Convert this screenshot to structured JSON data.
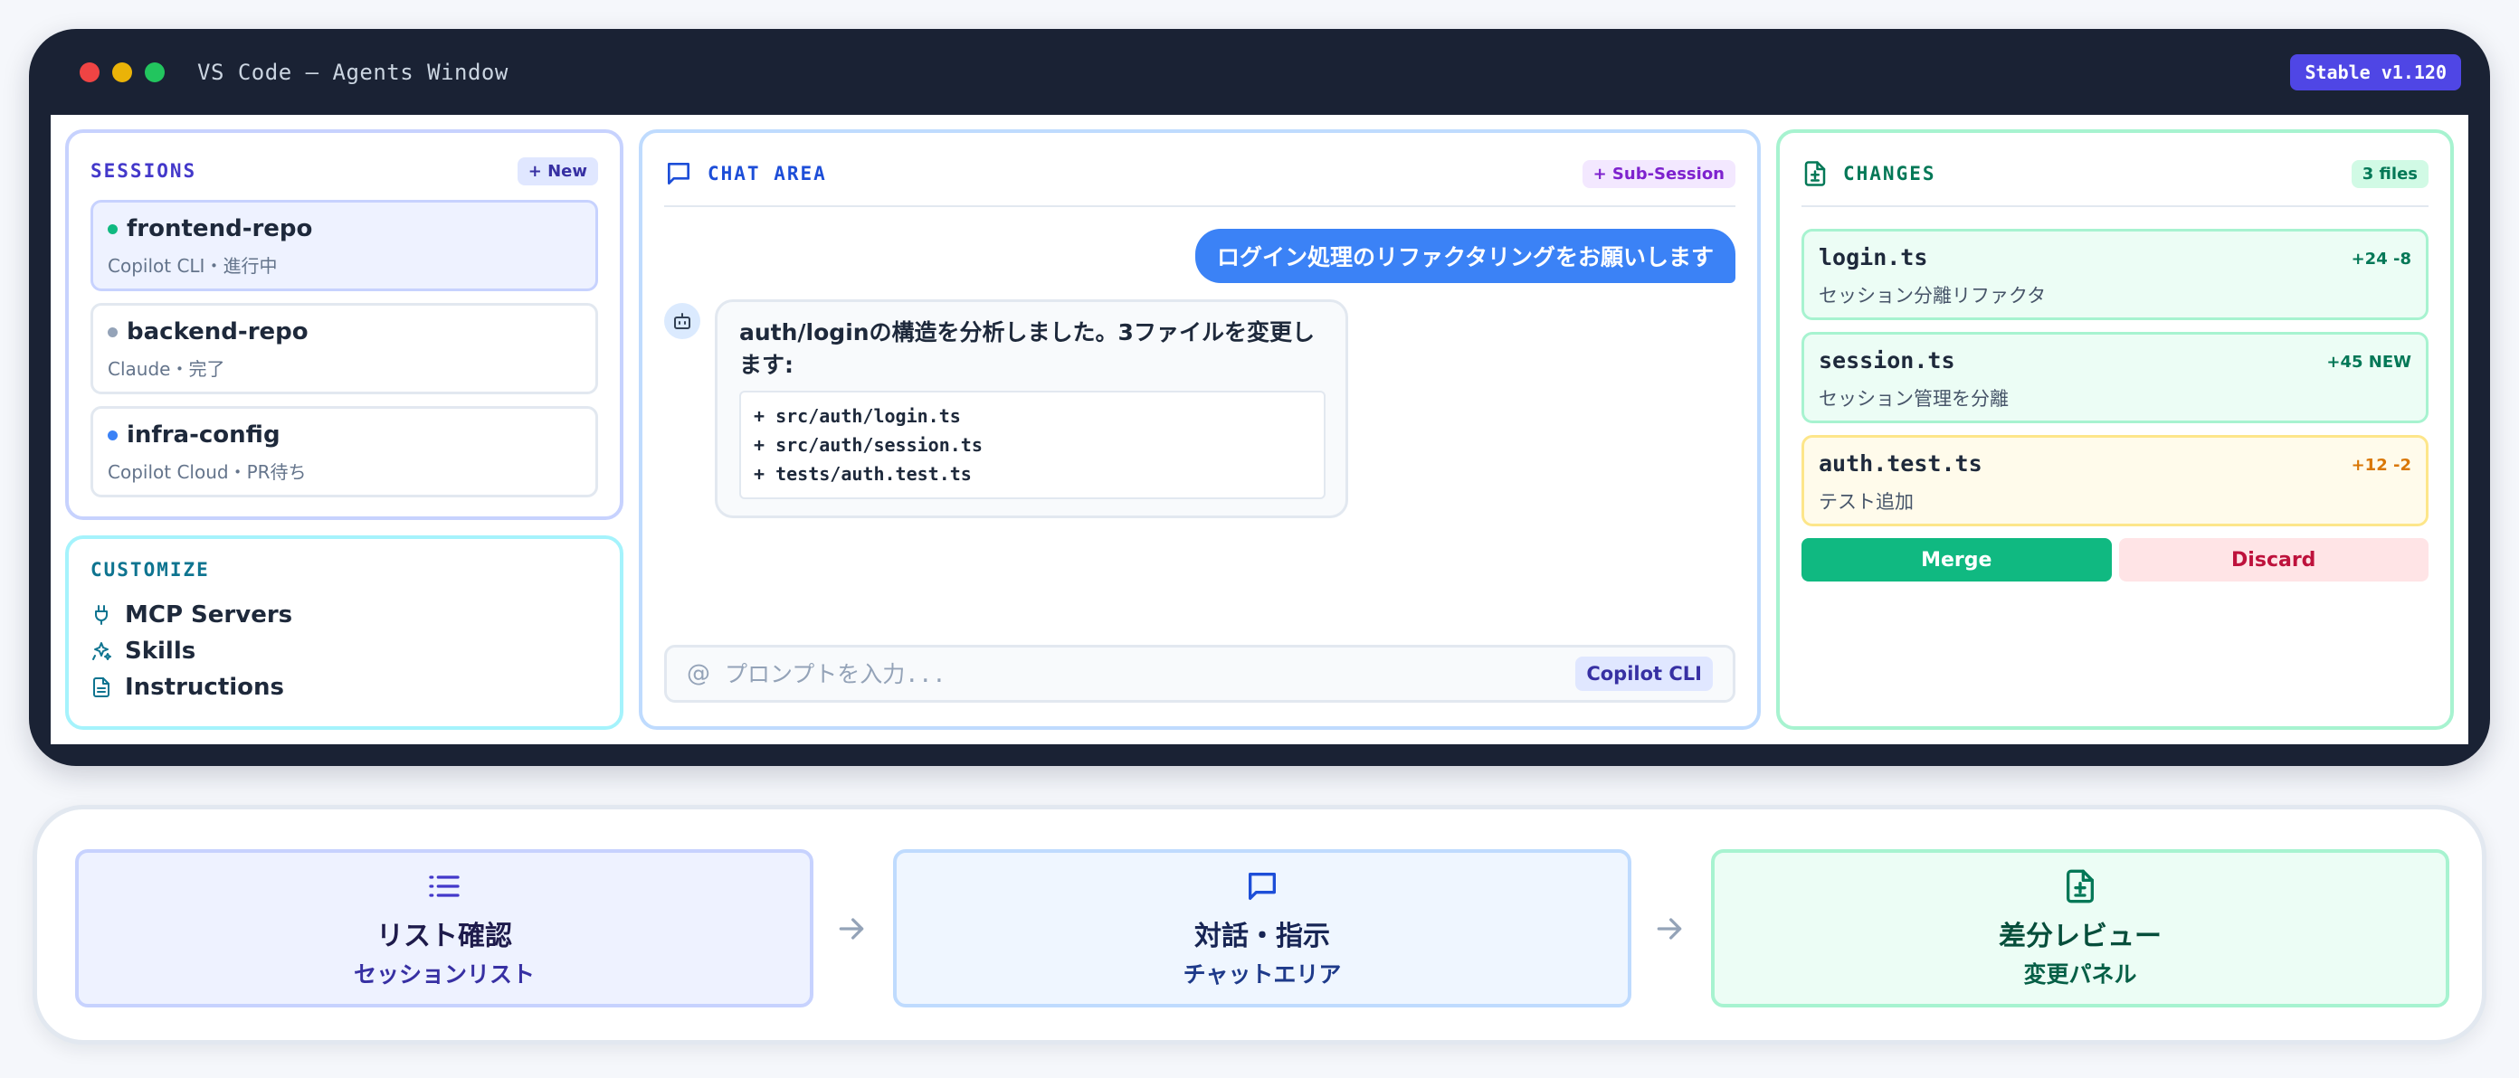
{
  "window": {
    "title": "VS Code — Agents Window",
    "version": "Stable v1.120"
  },
  "sessions": {
    "label": "SESSIONS",
    "new_label": "+ New",
    "items": [
      {
        "name": "frontend-repo",
        "meta": "Copilot CLI・進行中",
        "status_color": "#10b981"
      },
      {
        "name": "backend-repo",
        "meta": "Claude・完了",
        "status_color": "#94a3b8"
      },
      {
        "name": "infra-config",
        "meta": "Copilot Cloud・PR待ち",
        "status_color": "#3b82f6"
      }
    ]
  },
  "customize": {
    "label": "CUSTOMIZE",
    "items": [
      {
        "label": "MCP Servers",
        "icon": "plug-icon"
      },
      {
        "label": "Skills",
        "icon": "sparkles-icon"
      },
      {
        "label": "Instructions",
        "icon": "document-icon"
      }
    ]
  },
  "chat": {
    "label": "CHAT AREA",
    "sub_session_label": "+ Sub-Session",
    "user_message": "ログイン処理のリファクタリングをお願いします",
    "assistant_message": "auth/loginの構造を分析しました。3ファイルを変更します:",
    "code_lines": [
      "+ src/auth/login.ts",
      "+ src/auth/session.ts",
      "+ tests/auth.test.ts"
    ],
    "prompt_prefix": "@",
    "prompt_placeholder": "プロンプトを入力...",
    "model_badge": "Copilot CLI"
  },
  "changes": {
    "label": "CHANGES",
    "count_label": "3 files",
    "files": [
      {
        "name": "login.ts",
        "diff": "+24 -8",
        "desc": "セッション分離リファクタ"
      },
      {
        "name": "session.ts",
        "diff": "+45 NEW",
        "desc": "セッション管理を分離"
      },
      {
        "name": "auth.test.ts",
        "diff": "+12 -2",
        "desc": "テスト追加"
      }
    ],
    "merge_label": "Merge",
    "discard_label": "Discard"
  },
  "flow": {
    "steps": [
      {
        "title": "リスト確認",
        "subtitle": "セッションリスト",
        "icon": "list-icon"
      },
      {
        "title": "対話・指示",
        "subtitle": "チャットエリア",
        "icon": "chat-bubble-icon"
      },
      {
        "title": "差分レビュー",
        "subtitle": "変更パネル",
        "icon": "file-diff-icon"
      }
    ]
  },
  "colors": {
    "accent": "#4f46e5",
    "chat_accent": "#1d4ed8",
    "changes_accent": "#047857",
    "user_bubble": "#3b82f6",
    "merge": "#10b981",
    "discard_text": "#be123c"
  }
}
